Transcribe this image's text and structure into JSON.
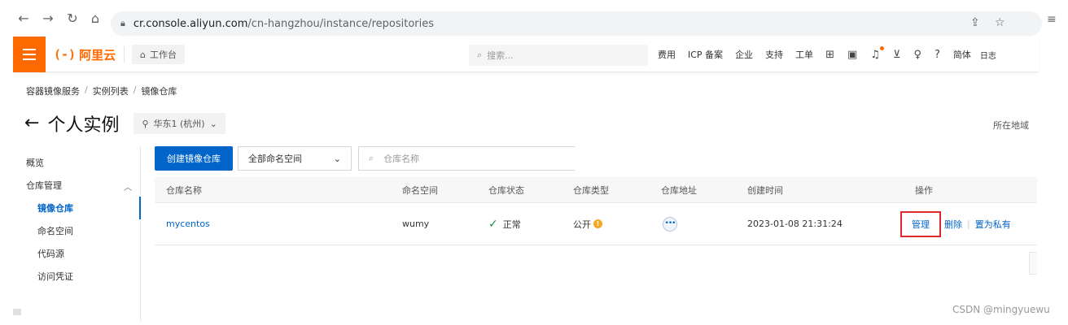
{
  "browser": {
    "url_host": "cr.console.aliyun.com",
    "url_path": "/cn-hangzhou/instance/repositories"
  },
  "header": {
    "logo_mark": "(-)",
    "logo_text": "阿里云",
    "workbench": "工作台",
    "search_placeholder": "搜索...",
    "links": [
      "费用",
      "ICP 备案",
      "企业",
      "支持",
      "工单"
    ],
    "lang": "简体",
    "cut_text": "日志",
    "accent_color": "#ff6a00"
  },
  "breadcrumb": [
    "容器镜像服务",
    "实例列表",
    "镜像仓库"
  ],
  "page": {
    "title": "个人实例",
    "region": "华东1 (杭州)",
    "region_right": "所在地域"
  },
  "sidebar": {
    "overview": "概览",
    "repo_mgmt": "仓库管理",
    "items": [
      "镜像仓库",
      "命名空间",
      "代码源",
      "访问凭证"
    ]
  },
  "toolbar": {
    "create_button": "创建镜像仓库",
    "namespace_select": "全部命名空间",
    "search_placeholder": "仓库名称"
  },
  "table": {
    "headers": [
      "仓库名称",
      "命名空间",
      "仓库状态",
      "仓库类型",
      "仓库地址",
      "创建时间",
      "操作"
    ],
    "rows": [
      {
        "name": "mycentos",
        "namespace": "wumy",
        "status": "正常",
        "type": "公开",
        "address_action": "•••",
        "created": "2023-01-08 21:31:24",
        "ops": [
          "管理",
          "删除",
          "置为私有"
        ]
      }
    ]
  },
  "watermark": "CSDN @mingyuewu"
}
